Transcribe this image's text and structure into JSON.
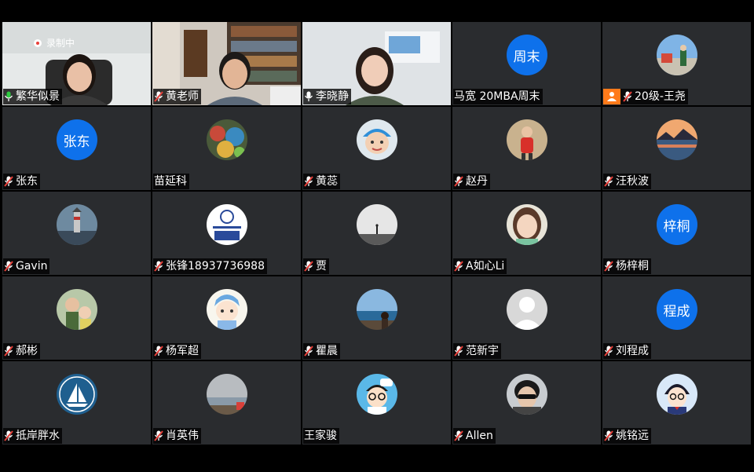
{
  "recording": {
    "label": "录制中"
  },
  "colors": {
    "avatar_blue": "#0e71eb",
    "active_border": "#2ecc40",
    "host_badge": "#ff7a1a",
    "tile_bg": "#2a2c2f"
  },
  "participants": [
    {
      "name": "繁华似景",
      "mic": "on",
      "tile": "video-woman-office",
      "active": true
    },
    {
      "name": "黄老师",
      "mic": "muted",
      "tile": "video-man-bookshelf"
    },
    {
      "name": "李晓静",
      "mic": "on",
      "tile": "video-woman-whiteboard"
    },
    {
      "name": "马宽 20MBA周末",
      "mic": "none",
      "avatar_text": "周末"
    },
    {
      "name": "20级-王尧",
      "mic": "muted",
      "host_badge": "person-icon",
      "avatar_icon": "photo-outdoor-person"
    },
    {
      "name": "张东",
      "mic": "muted",
      "avatar_text": "张东"
    },
    {
      "name": "苗延科",
      "mic": "none",
      "avatar_icon": "photo-colorful-crowd"
    },
    {
      "name": "黄蕊",
      "mic": "muted",
      "avatar_icon": "photo-child-cap"
    },
    {
      "name": "赵丹",
      "mic": "muted",
      "avatar_icon": "photo-child-red"
    },
    {
      "name": "汪秋波",
      "mic": "muted",
      "avatar_icon": "photo-lake-sunset"
    },
    {
      "name": "Gavin",
      "mic": "muted",
      "avatar_icon": "photo-lighthouse"
    },
    {
      "name": "张锋18937736988",
      "mic": "muted",
      "avatar_icon": "logo-40-badge"
    },
    {
      "name": "贾",
      "mic": "muted",
      "avatar_icon": "photo-silhouette-light"
    },
    {
      "name": "A如心Li",
      "mic": "muted",
      "avatar_icon": "photo-girl-portrait"
    },
    {
      "name": "杨梓桐",
      "mic": "muted",
      "avatar_text": "梓桐"
    },
    {
      "name": "郝彬",
      "mic": "muted",
      "avatar_icon": "photo-man-child"
    },
    {
      "name": "杨军超",
      "mic": "muted",
      "avatar_icon": "cartoon-boy-blue"
    },
    {
      "name": "瞿晨",
      "mic": "muted",
      "avatar_icon": "photo-beach-woman"
    },
    {
      "name": "范新宇",
      "mic": "muted",
      "avatar_icon": "default-person-icon"
    },
    {
      "name": "刘程成",
      "mic": "muted",
      "avatar_text": "程成"
    },
    {
      "name": "抵岸胖水",
      "mic": "muted",
      "avatar_icon": "logo-sailboat"
    },
    {
      "name": "肖英伟",
      "mic": "muted",
      "avatar_icon": "photo-coast-cloudy"
    },
    {
      "name": "王家骏",
      "mic": "none",
      "avatar_icon": "cartoon-boy-glasses"
    },
    {
      "name": "Allen",
      "mic": "muted",
      "avatar_icon": "photo-sunglasses-man"
    },
    {
      "name": "姚铭远",
      "mic": "muted",
      "avatar_icon": "cartoon-detective"
    }
  ]
}
